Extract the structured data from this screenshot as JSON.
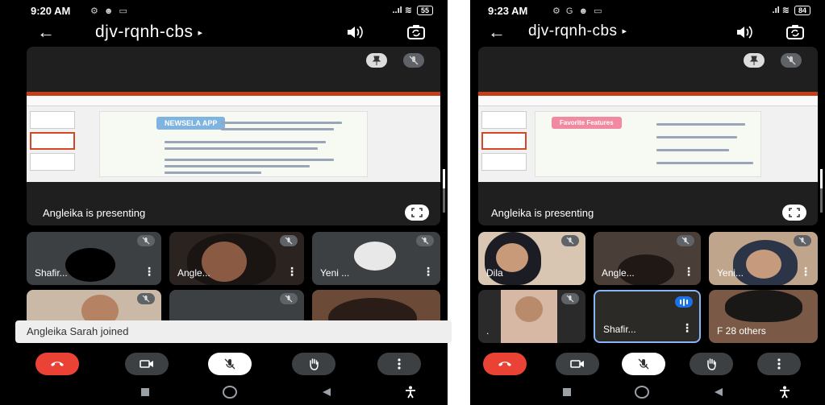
{
  "phones": [
    {
      "status": {
        "time": "9:20 AM",
        "icons": "⚙ ☻ ▭",
        "signal": "..ıl ≋",
        "battery": "55"
      },
      "meeting_code": "djv-rqnh-cbs",
      "caret": "▸",
      "presenting_label": "Angleika is presenting",
      "slide_title": "NEWSELA APP",
      "tiles": [
        {
          "name": "Shafir...",
          "muted": true
        },
        {
          "name": "Angle...",
          "muted": true
        },
        {
          "name": "Yeni ...",
          "muted": true
        },
        {
          "name": "",
          "muted": true
        },
        {
          "name": "",
          "muted": true
        },
        {
          "name": "",
          "muted": false
        }
      ],
      "toast": "Angleika Sarah joined"
    },
    {
      "status": {
        "time": "9:23 AM",
        "icons": "⚙ G ☻ ▭",
        "signal": ".ıl ≋",
        "battery": "84"
      },
      "meeting_code": "djv-rqnh-cbs",
      "caret": "▸",
      "presenting_label": "Angleika is presenting",
      "slide_title": "Favorite Features",
      "tiles": [
        {
          "name": "Dila",
          "muted": true
        },
        {
          "name": "Angle...",
          "muted": true
        },
        {
          "name": "Yeni...",
          "muted": true
        },
        {
          "name": ".",
          "muted": true
        },
        {
          "name": "Shafir...",
          "muted": false,
          "speaking": true
        },
        {
          "name": "F 28 others",
          "muted": false
        }
      ]
    }
  ],
  "colors": {
    "end_call": "#ea4335",
    "tile_bg": "#3c4043",
    "speaking_border": "#8ab4f8"
  },
  "icons": [
    "back-arrow-icon",
    "speaker-icon",
    "camera-switch-icon",
    "pin-icon",
    "mic-off-icon",
    "fullscreen-icon",
    "end-call-icon",
    "camera-icon",
    "raise-hand-icon",
    "more-icon",
    "menu-dots-icon"
  ]
}
